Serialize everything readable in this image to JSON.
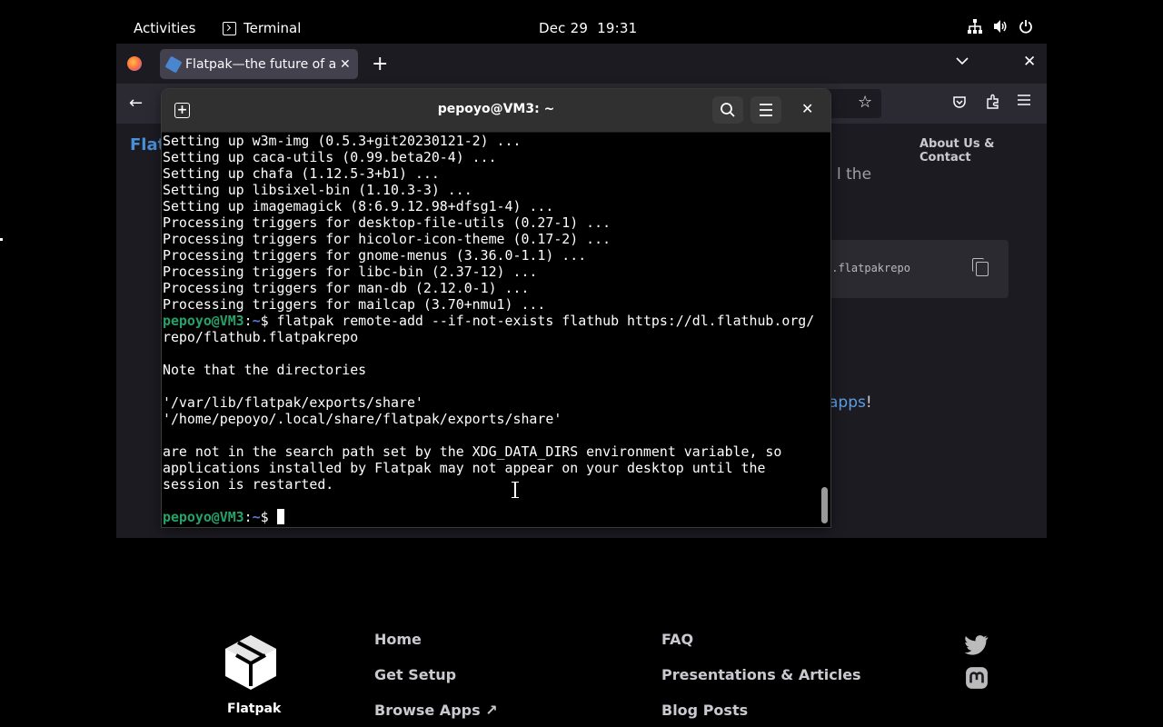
{
  "topbar": {
    "activities": "Activities",
    "app_name": "Terminal",
    "date": "Dec 29",
    "time": "19:31",
    "icons": [
      "network-icon",
      "volume-icon",
      "power-icon"
    ]
  },
  "firefox": {
    "tab_title": "Flatpak—the future of apps",
    "new_tab": "+",
    "tabs_list": "⌄",
    "close": "✕",
    "back": "←",
    "page": {
      "site_logo_fragment": "Flat",
      "about_link": "About Us & Contact",
      "text_fragment": "l the",
      "code_fragment": "o.flatpakrepo",
      "apps_link": "apps",
      "apps_bang": "!"
    },
    "footer": {
      "brand": "Flatpak",
      "col1": [
        "Home",
        "Get Setup",
        "Browse Apps ↗"
      ],
      "col2": [
        "FAQ",
        "Presentations & Articles",
        "Blog Posts"
      ],
      "social": [
        "twitter-icon",
        "mastodon-icon"
      ]
    }
  },
  "terminal": {
    "title": "pepoyo@VM3: ~",
    "prompt_user": "pepoyo@VM3",
    "prompt_path": "~",
    "lines": [
      {
        "type": "out",
        "text": "Setting up w3m-img (0.5.3+git20230121-2) ..."
      },
      {
        "type": "out",
        "text": "Setting up caca-utils (0.99.beta20-4) ..."
      },
      {
        "type": "out",
        "text": "Setting up chafa (1.12.5-3+b1) ..."
      },
      {
        "type": "out",
        "text": "Setting up libsixel-bin (1.10.3-3) ..."
      },
      {
        "type": "out",
        "text": "Setting up imagemagick (8:6.9.12.98+dfsg1-4) ..."
      },
      {
        "type": "out",
        "text": "Processing triggers for desktop-file-utils (0.27-1) ..."
      },
      {
        "type": "out",
        "text": "Processing triggers for hicolor-icon-theme (0.17-2) ..."
      },
      {
        "type": "out",
        "text": "Processing triggers for gnome-menus (3.36.0-1.1) ..."
      },
      {
        "type": "out",
        "text": "Processing triggers for libc-bin (2.37-12) ..."
      },
      {
        "type": "out",
        "text": "Processing triggers for man-db (2.12.0-1) ..."
      },
      {
        "type": "out",
        "text": "Processing triggers for mailcap (3.70+nmu1) ..."
      },
      {
        "type": "prompt",
        "text": "flatpak remote-add --if-not-exists flathub https://dl.flathub.org/"
      },
      {
        "type": "out",
        "text": "repo/flathub.flatpakrepo"
      },
      {
        "type": "out",
        "text": ""
      },
      {
        "type": "out",
        "text": "Note that the directories"
      },
      {
        "type": "out",
        "text": ""
      },
      {
        "type": "out",
        "text": "'/var/lib/flatpak/exports/share'"
      },
      {
        "type": "out",
        "text": "'/home/pepoyo/.local/share/flatpak/exports/share'"
      },
      {
        "type": "out",
        "text": ""
      },
      {
        "type": "out",
        "text": "are not in the search path set by the XDG_DATA_DIRS environment variable, so"
      },
      {
        "type": "out",
        "text": "applications installed by Flatpak may not appear on your desktop until the"
      },
      {
        "type": "out",
        "text": "session is restarted."
      },
      {
        "type": "out",
        "text": ""
      },
      {
        "type": "prompt",
        "text": ""
      }
    ]
  }
}
